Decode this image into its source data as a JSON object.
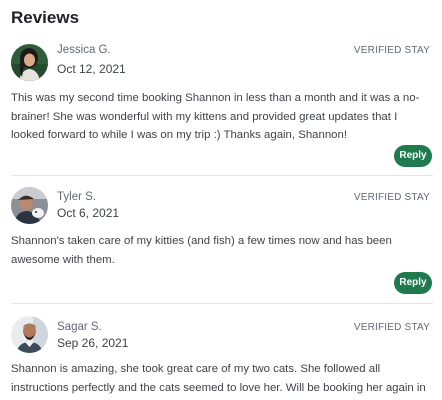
{
  "section": {
    "title": "Reviews"
  },
  "reviews": [
    {
      "name": "Jessica G.",
      "date": "Oct 12, 2021",
      "badge": "VERIFIED STAY",
      "text": "This was my second time booking Shannon in less than a month and it was a no-brainer! She was wonderful with my kittens and provided great updates that I looked forward to while I was on my trip :) Thanks again, Shannon!",
      "reply_label": "Reply"
    },
    {
      "name": "Tyler S.",
      "date": "Oct 6, 2021",
      "badge": "VERIFIED STAY",
      "text": "Shannon's taken care of my kitties (and fish) a few times now and has been awesome with them.",
      "reply_label": "Reply"
    },
    {
      "name": "Sagar S.",
      "date": "Sep 26, 2021",
      "badge": "VERIFIED STAY",
      "text": "Shannon is amazing, she took great care of my two cats. She followed all instructions perfectly and the cats seemed to love her. Will be booking her again in the future"
    }
  ],
  "colors": {
    "accent": "#1f7a4d",
    "divider": "#e6e6e9"
  }
}
